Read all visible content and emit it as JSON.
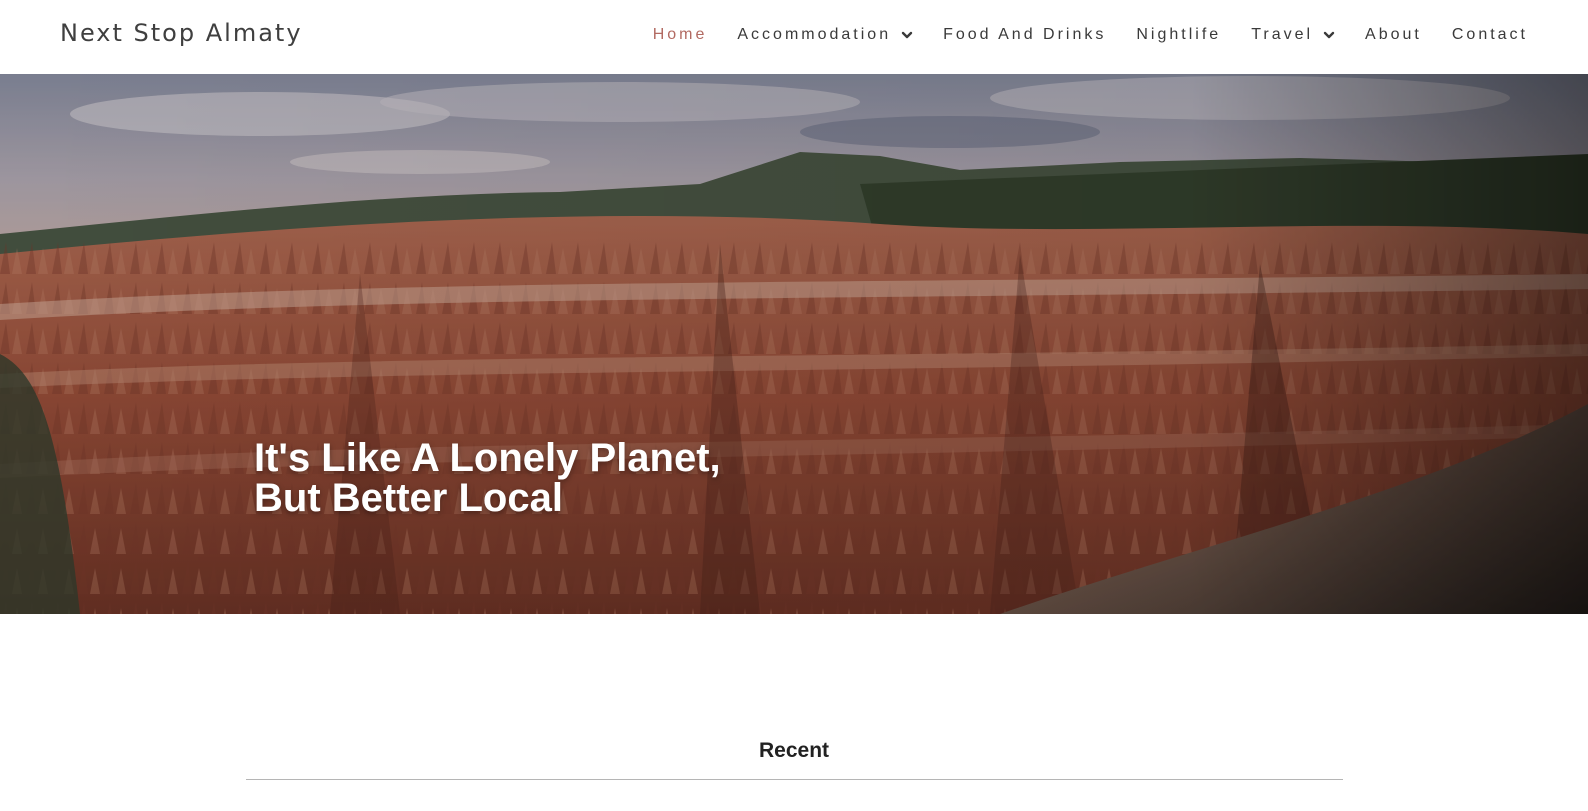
{
  "site": {
    "title": "Next Stop Almaty"
  },
  "nav": {
    "items": [
      {
        "label": "Home",
        "active": true,
        "has_dropdown": false
      },
      {
        "label": "Accommodation",
        "active": false,
        "has_dropdown": true
      },
      {
        "label": "Food And Drinks",
        "active": false,
        "has_dropdown": false
      },
      {
        "label": "Nightlife",
        "active": false,
        "has_dropdown": false
      },
      {
        "label": "Travel",
        "active": false,
        "has_dropdown": true
      },
      {
        "label": "About",
        "active": false,
        "has_dropdown": false
      },
      {
        "label": "Contact",
        "active": false,
        "has_dropdown": false
      }
    ],
    "dropdown_icon": "chevron-down-icon"
  },
  "hero": {
    "title_line1": "It's Like A Lonely Planet,",
    "title_line2": "But Better Local",
    "image": "red-rock-canyon-landscape"
  },
  "recent": {
    "heading": "Recent"
  },
  "colors": {
    "accent": "#b26a62",
    "nav_text": "#3a3a3a",
    "divider": "#b5b5b5"
  }
}
